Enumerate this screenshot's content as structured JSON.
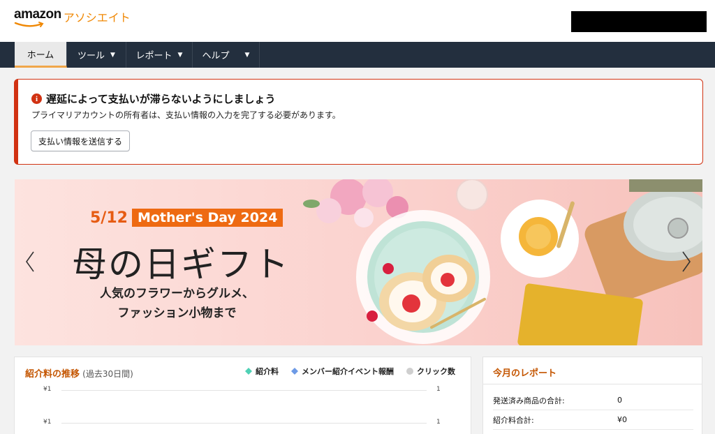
{
  "header": {
    "logo_word": "amazon",
    "logo_sub": "アソシエイト"
  },
  "nav": {
    "items": [
      {
        "label": "ホーム",
        "active": true
      },
      {
        "label": "ツール",
        "dropdown": true
      },
      {
        "label": "レポート",
        "dropdown": true
      },
      {
        "label": "ヘルプ",
        "dropdown": true
      }
    ]
  },
  "alert": {
    "title": "遅延によって支払いが滞らないようにしましょう",
    "description": "プライマリアカウントの所有者は、支払い情報の入力を完了する必要があります。",
    "button_label": "支払い情報を送信する"
  },
  "banner": {
    "date": "5/12",
    "tag": "Mother's Day 2024",
    "title": "母の日ギフト",
    "subtitle_line1": "人気のフラワーからグルメ、",
    "subtitle_line2": "ファッション小物まで"
  },
  "chart_panel": {
    "title": "紹介料の推移",
    "range": "(過去30日間)",
    "legend": [
      {
        "label": "紹介料",
        "color": "#4fd1b5",
        "shape": "diamond"
      },
      {
        "label": "メンバー紹介イベント報酬",
        "color": "#6d9ae6",
        "shape": "diamond"
      },
      {
        "label": "クリック数",
        "color": "#cfcfcf",
        "shape": "circle"
      }
    ],
    "y_left_ticks": [
      "¥1",
      "¥1"
    ],
    "y_right_ticks": [
      "1",
      "1"
    ]
  },
  "report_panel": {
    "title": "今月のレポート",
    "rows": [
      {
        "label": "発送済み商品の合計:",
        "value": "0"
      },
      {
        "label": "紹介料合計:",
        "value": "¥0"
      }
    ]
  },
  "colors": {
    "nav_bg": "#232f3e",
    "accent_orange": "#c45500",
    "alert_red": "#d13212",
    "logo_orange": "#f08804"
  }
}
